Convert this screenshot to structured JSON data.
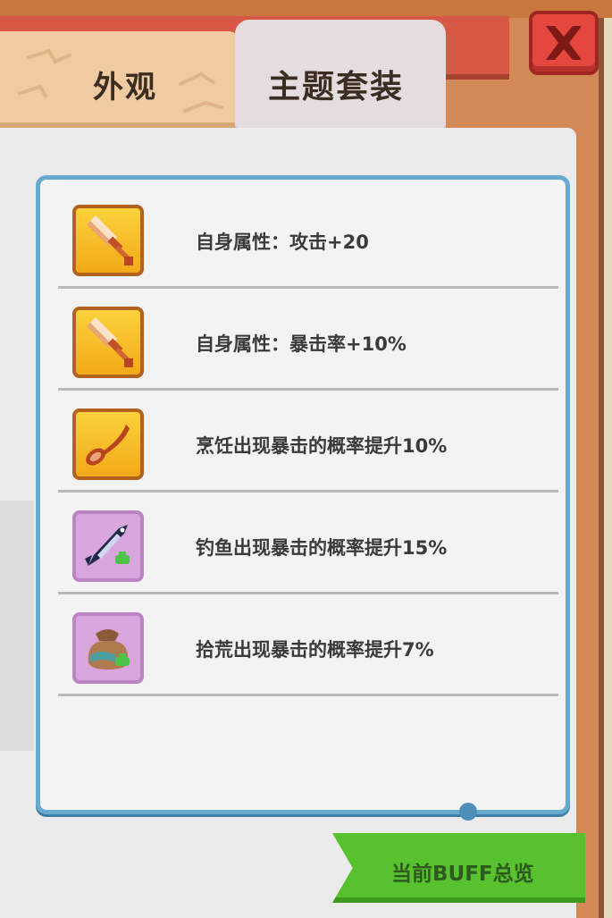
{
  "tabs": [
    {
      "label": "外观",
      "active": false
    },
    {
      "label": "主题套装",
      "active": true
    }
  ],
  "attributes": [
    {
      "icon": "sword-icon",
      "text": "自身属性：攻击+20"
    },
    {
      "icon": "sword-icon",
      "text": "自身属性：暴击率+10%"
    },
    {
      "icon": "spoon-icon",
      "text": "烹饪出现暴击的概率提升10%"
    },
    {
      "icon": "fish-icon",
      "text": "钓鱼出现暴击的概率提升15%"
    },
    {
      "icon": "sack-icon",
      "text": "拾荒出现暴击的概率提升7%"
    }
  ],
  "buff_button_label": "当前BUFF总览",
  "colors": {
    "frame": "#d48a57",
    "header": "#d65845",
    "panel": "#ebebeb",
    "list_border": "#68a9cf",
    "buff_button": "#57c12e"
  }
}
